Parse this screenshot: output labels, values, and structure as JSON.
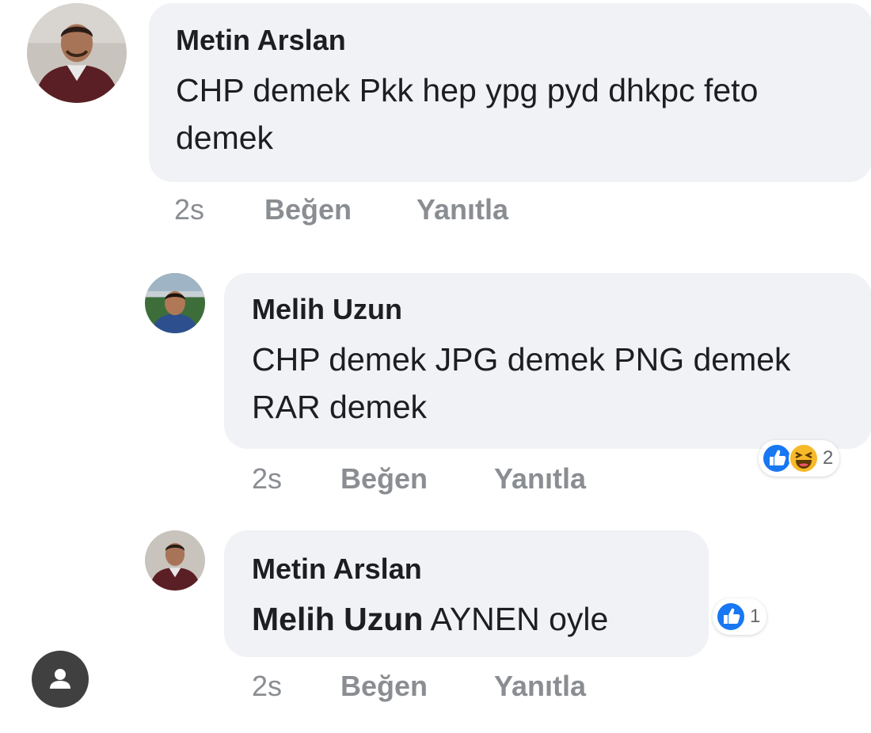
{
  "comments": [
    {
      "author": "Metin Arslan",
      "text": "CHP demek Pkk hep ypg pyd dhkpc feto demek",
      "time": "2s",
      "like_label": "Beğen",
      "reply_label": "Yanıtla"
    },
    {
      "author": "Melih Uzun",
      "text": "CHP demek JPG demek PNG demek RAR demek",
      "time": "2s",
      "like_label": "Beğen",
      "reply_label": "Yanıtla",
      "reactions": {
        "icons": [
          "like-icon",
          "haha-icon"
        ],
        "count": "2"
      }
    },
    {
      "author": "Metin Arslan",
      "mention": "Melih Uzun",
      "text": "AYNEN oyle",
      "time": "2s",
      "like_label": "Beğen",
      "reply_label": "Yanıtla",
      "reactions": {
        "icons": [
          "like-icon"
        ],
        "count": "1"
      }
    }
  ],
  "colors": {
    "bubble": "#f0f2f5",
    "action_text": "#8a8d91",
    "like_blue": "#1877f2",
    "haha_yellow": "#f7b928"
  },
  "profile_button_icon": "person-icon"
}
